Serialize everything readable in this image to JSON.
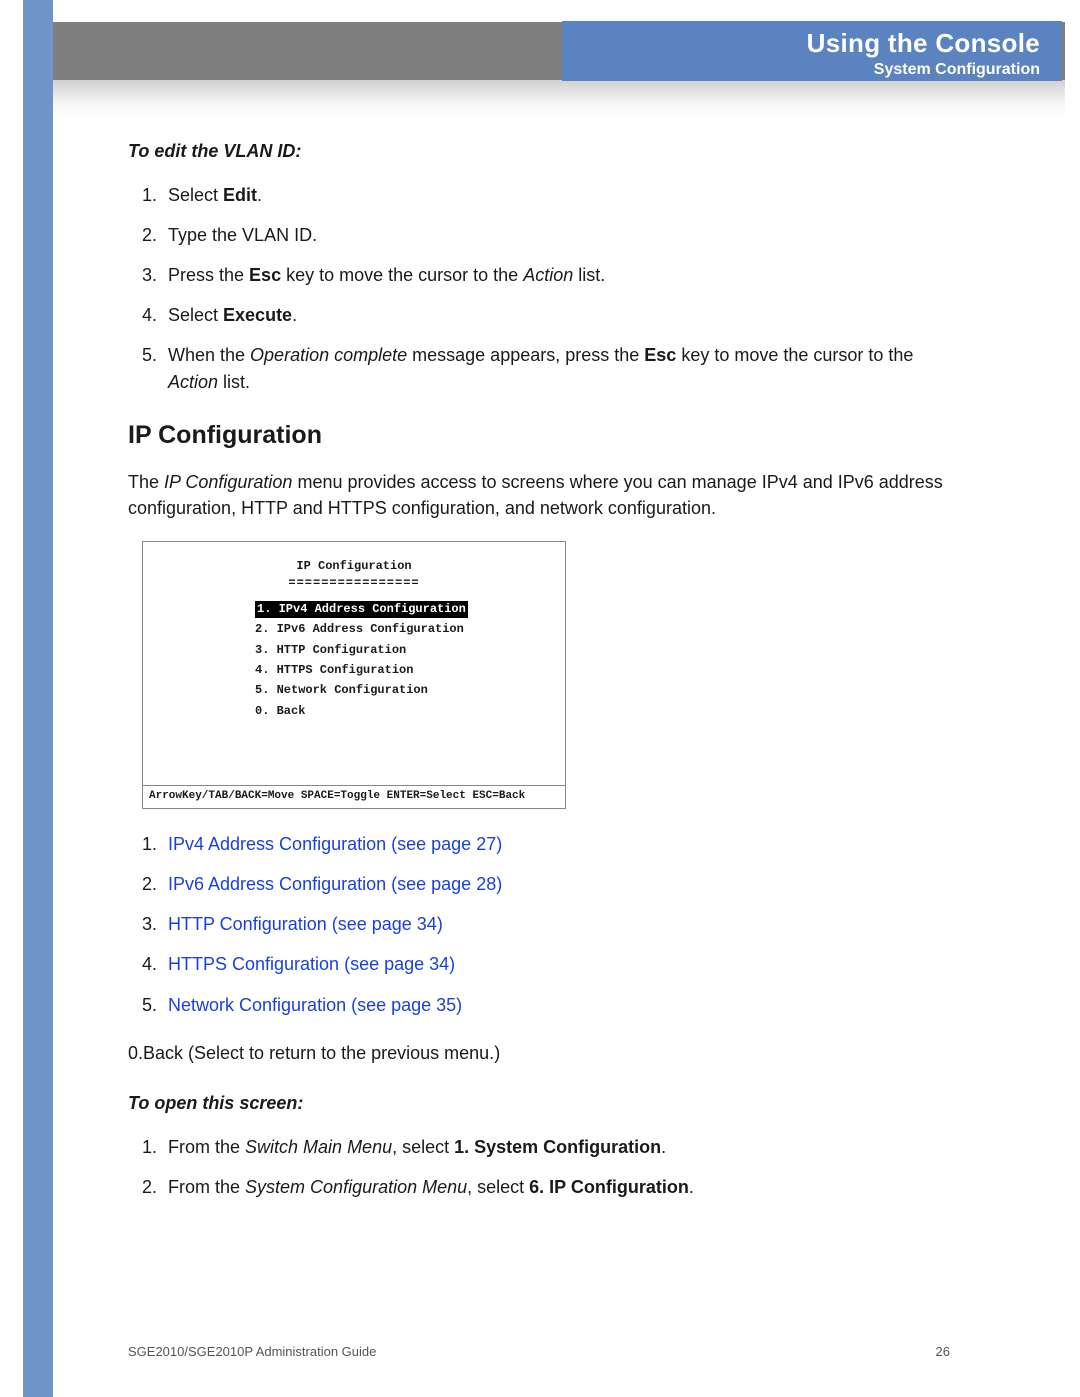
{
  "header": {
    "title": "Using the Console",
    "subtitle": "System Configuration"
  },
  "section1": {
    "heading": "To edit the VLAN ID:",
    "steps": {
      "s1a": "Select ",
      "s1b": "Edit",
      "s1c": ".",
      "s2": "Type the VLAN ID.",
      "s3a": "Press the ",
      "s3b": "Esc",
      "s3c": " key to move the cursor to the ",
      "s3d": "Action",
      "s3e": " list.",
      "s4a": "Select ",
      "s4b": "Execute",
      "s4c": ".",
      "s5a": "When the ",
      "s5b": "Operation complete",
      "s5c": " message appears, press the ",
      "s5d": "Esc",
      "s5e": " key to move the cursor to the ",
      "s5f": "Action",
      "s5g": " list."
    }
  },
  "section2": {
    "heading": "IP Configuration",
    "intro_a": "The ",
    "intro_b": "IP Configuration",
    "intro_c": " menu provides access to screens where you can manage IPv4 and IPv6 address configuration, HTTP and HTTPS configuration, and network configuration."
  },
  "console": {
    "title": "IP Configuration",
    "underline": "================",
    "items": {
      "i1": "1. IPv4 Address Configuration",
      "i2": "2. IPv6 Address Configuration",
      "i3": "3. HTTP Configuration",
      "i4": "4. HTTPS Configuration",
      "i5": "5. Network Configuration",
      "i0": "0. Back"
    },
    "hint": "ArrowKey/TAB/BACK=Move  SPACE=Toggle  ENTER=Select  ESC=Back"
  },
  "links": {
    "l1": "IPv4 Address Configuration (see page 27)",
    "l2": "IPv6 Address Configuration (see page 28)",
    "l3": "HTTP Configuration (see page 34)",
    "l4": "HTTPS Configuration (see page 34)",
    "l5": "Network Configuration (see page 35)"
  },
  "back_line": "0.Back (Select to return to the previous menu.)",
  "section3": {
    "heading": "To open this screen:",
    "s1a": "From the ",
    "s1b": "Switch Main Menu",
    "s1c": ", select ",
    "s1d": "1. System Configuration",
    "s1e": ".",
    "s2a": "From the ",
    "s2b": "System Configuration Menu",
    "s2c": ", select ",
    "s2d": "6. IP Configuration",
    "s2e": "."
  },
  "footer": {
    "left": "SGE2010/SGE2010P Administration Guide",
    "right": "26"
  }
}
